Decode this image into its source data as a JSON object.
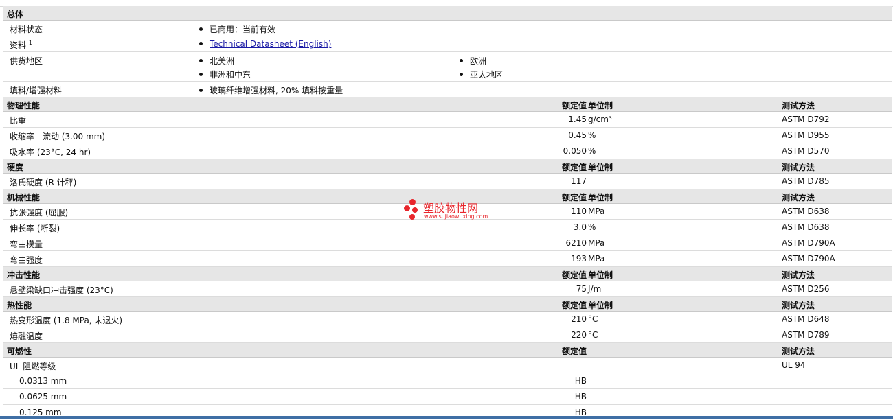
{
  "general": {
    "header": "总体",
    "material_status": {
      "label": "材料状态",
      "value": "已商用：当前有效"
    },
    "resources": {
      "label": "资料",
      "sup": "1",
      "link": "Technical Datasheet (English)"
    },
    "availability": {
      "label": "供货地区",
      "regions": [
        "北美洲",
        "欧洲",
        "非洲和中东",
        "亚太地区"
      ]
    },
    "filler": {
      "label": "填料/增强材料",
      "value": "玻璃纤维增强材料, 20% 填料按重量"
    }
  },
  "col_headers": {
    "value": "额定值",
    "unit": "单位制",
    "test": "测试方法"
  },
  "physical": {
    "header": "物理性能",
    "rows": [
      {
        "label": "比重",
        "value": "1.45",
        "unit": "g/cm³",
        "test": "ASTM D792"
      },
      {
        "label": "收缩率 - 流动 (3.00 mm)",
        "value": "0.45",
        "unit": "%",
        "test": "ASTM D955"
      },
      {
        "label": "吸水率 (23°C, 24 hr)",
        "value": "0.050",
        "unit": "%",
        "test": "ASTM D570"
      }
    ]
  },
  "hardness": {
    "header": "硬度",
    "rows": [
      {
        "label": "洛氏硬度 (R 计秤)",
        "value": "117",
        "unit": "",
        "test": "ASTM D785"
      }
    ]
  },
  "mechanical": {
    "header": "机械性能",
    "rows": [
      {
        "label": "抗张强度 (屈服)",
        "value": "110",
        "unit": "MPa",
        "test": "ASTM D638"
      },
      {
        "label": "伸长率 (断裂)",
        "value": "3.0",
        "unit": "%",
        "test": "ASTM D638"
      },
      {
        "label": "弯曲模量",
        "value": "6210",
        "unit": "MPa",
        "test": "ASTM D790A"
      },
      {
        "label": "弯曲强度",
        "value": "193",
        "unit": "MPa",
        "test": "ASTM D790A"
      }
    ]
  },
  "impact": {
    "header": "冲击性能",
    "rows": [
      {
        "label": "悬壁梁缺口冲击强度 (23°C)",
        "value": "75",
        "unit": "J/m",
        "test": "ASTM D256"
      }
    ]
  },
  "thermal": {
    "header": "热性能",
    "rows": [
      {
        "label": "热变形温度 (1.8 MPa, 未退火)",
        "value": "210",
        "unit": "°C",
        "test": "ASTM D648"
      },
      {
        "label": "熔融温度",
        "value": "220",
        "unit": "°C",
        "test": "ASTM D789"
      }
    ]
  },
  "flammability": {
    "header": "可燃性",
    "ul_label": "UL 阻燃等级",
    "ul_test": "UL 94",
    "rows": [
      {
        "label": "0.0313 mm",
        "value": "HB"
      },
      {
        "label": "0.0625 mm",
        "value": "HB"
      },
      {
        "label": "0.125 mm",
        "value": "HB"
      }
    ]
  },
  "watermark": {
    "title": "塑胶物性网",
    "url": "www.sujiaowuxing.com"
  },
  "colors": {
    "header_bg": "#e6e6e6",
    "link": "#1a1aa6",
    "watermark": "#e8262c",
    "bottom_bar": "#3f6fa5"
  }
}
